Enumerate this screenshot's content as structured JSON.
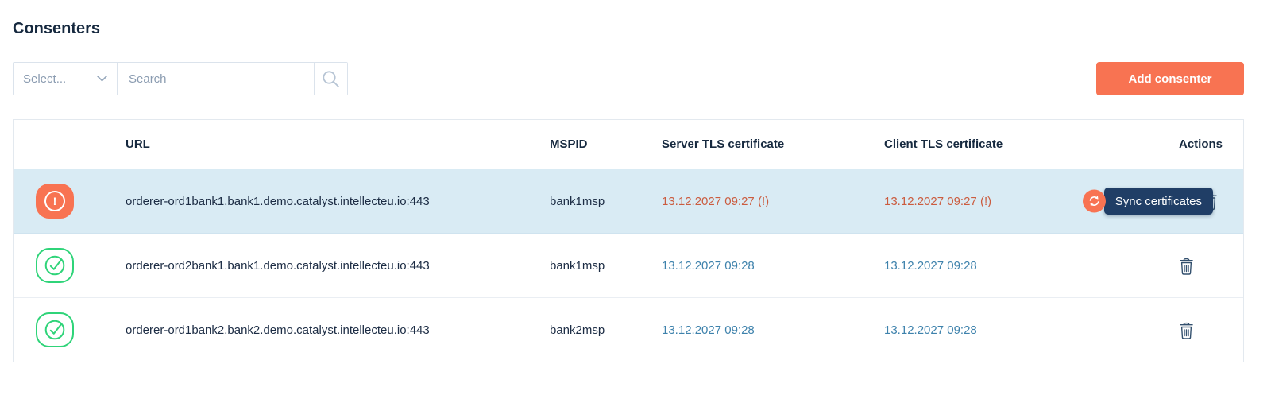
{
  "page": {
    "title": "Consenters"
  },
  "toolbar": {
    "select_placeholder": "Select...",
    "search_placeholder": "Search",
    "add_button_label": "Add consenter"
  },
  "table": {
    "columns": {
      "url": "URL",
      "mspid": "MSPID",
      "server": "Server TLS certificate",
      "client": "Client TLS certificate",
      "actions": "Actions"
    },
    "rows": [
      {
        "status": "warning",
        "url": "orderer-ord1bank1.bank1.demo.catalyst.intellecteu.io:443",
        "mspid": "bank1msp",
        "server_tls": "13.12.2027 09:27 (!)",
        "client_tls": "13.12.2027 09:27 (!)",
        "selected": true
      },
      {
        "status": "ok",
        "url": "orderer-ord2bank1.bank1.demo.catalyst.intellecteu.io:443",
        "mspid": "bank1msp",
        "server_tls": "13.12.2027 09:28",
        "client_tls": "13.12.2027 09:28",
        "selected": false
      },
      {
        "status": "ok",
        "url": "orderer-ord1bank2.bank2.demo.catalyst.intellecteu.io:443",
        "mspid": "bank2msp",
        "server_tls": "13.12.2027 09:28",
        "client_tls": "13.12.2027 09:28",
        "selected": false
      }
    ]
  },
  "tooltip": {
    "sync_label": "Sync certificates"
  },
  "status": {
    "warning_glyph": "!"
  },
  "icons": {
    "select_chevron": "chevron-down-icon",
    "search": "search-icon",
    "warning": "alert-circle-icon",
    "ok": "check-circle-icon",
    "sync": "sync-icon",
    "delete": "trash-icon"
  },
  "colors": {
    "accent_orange": "#F87352",
    "selected_row_bg": "#D9EBF4",
    "ok_green": "#2FD479",
    "cert_link_blue": "#3E82AC",
    "cert_warning_text": "#CB5C3F",
    "tooltip_bg": "#203E66",
    "heading_navy": "#16293F"
  }
}
